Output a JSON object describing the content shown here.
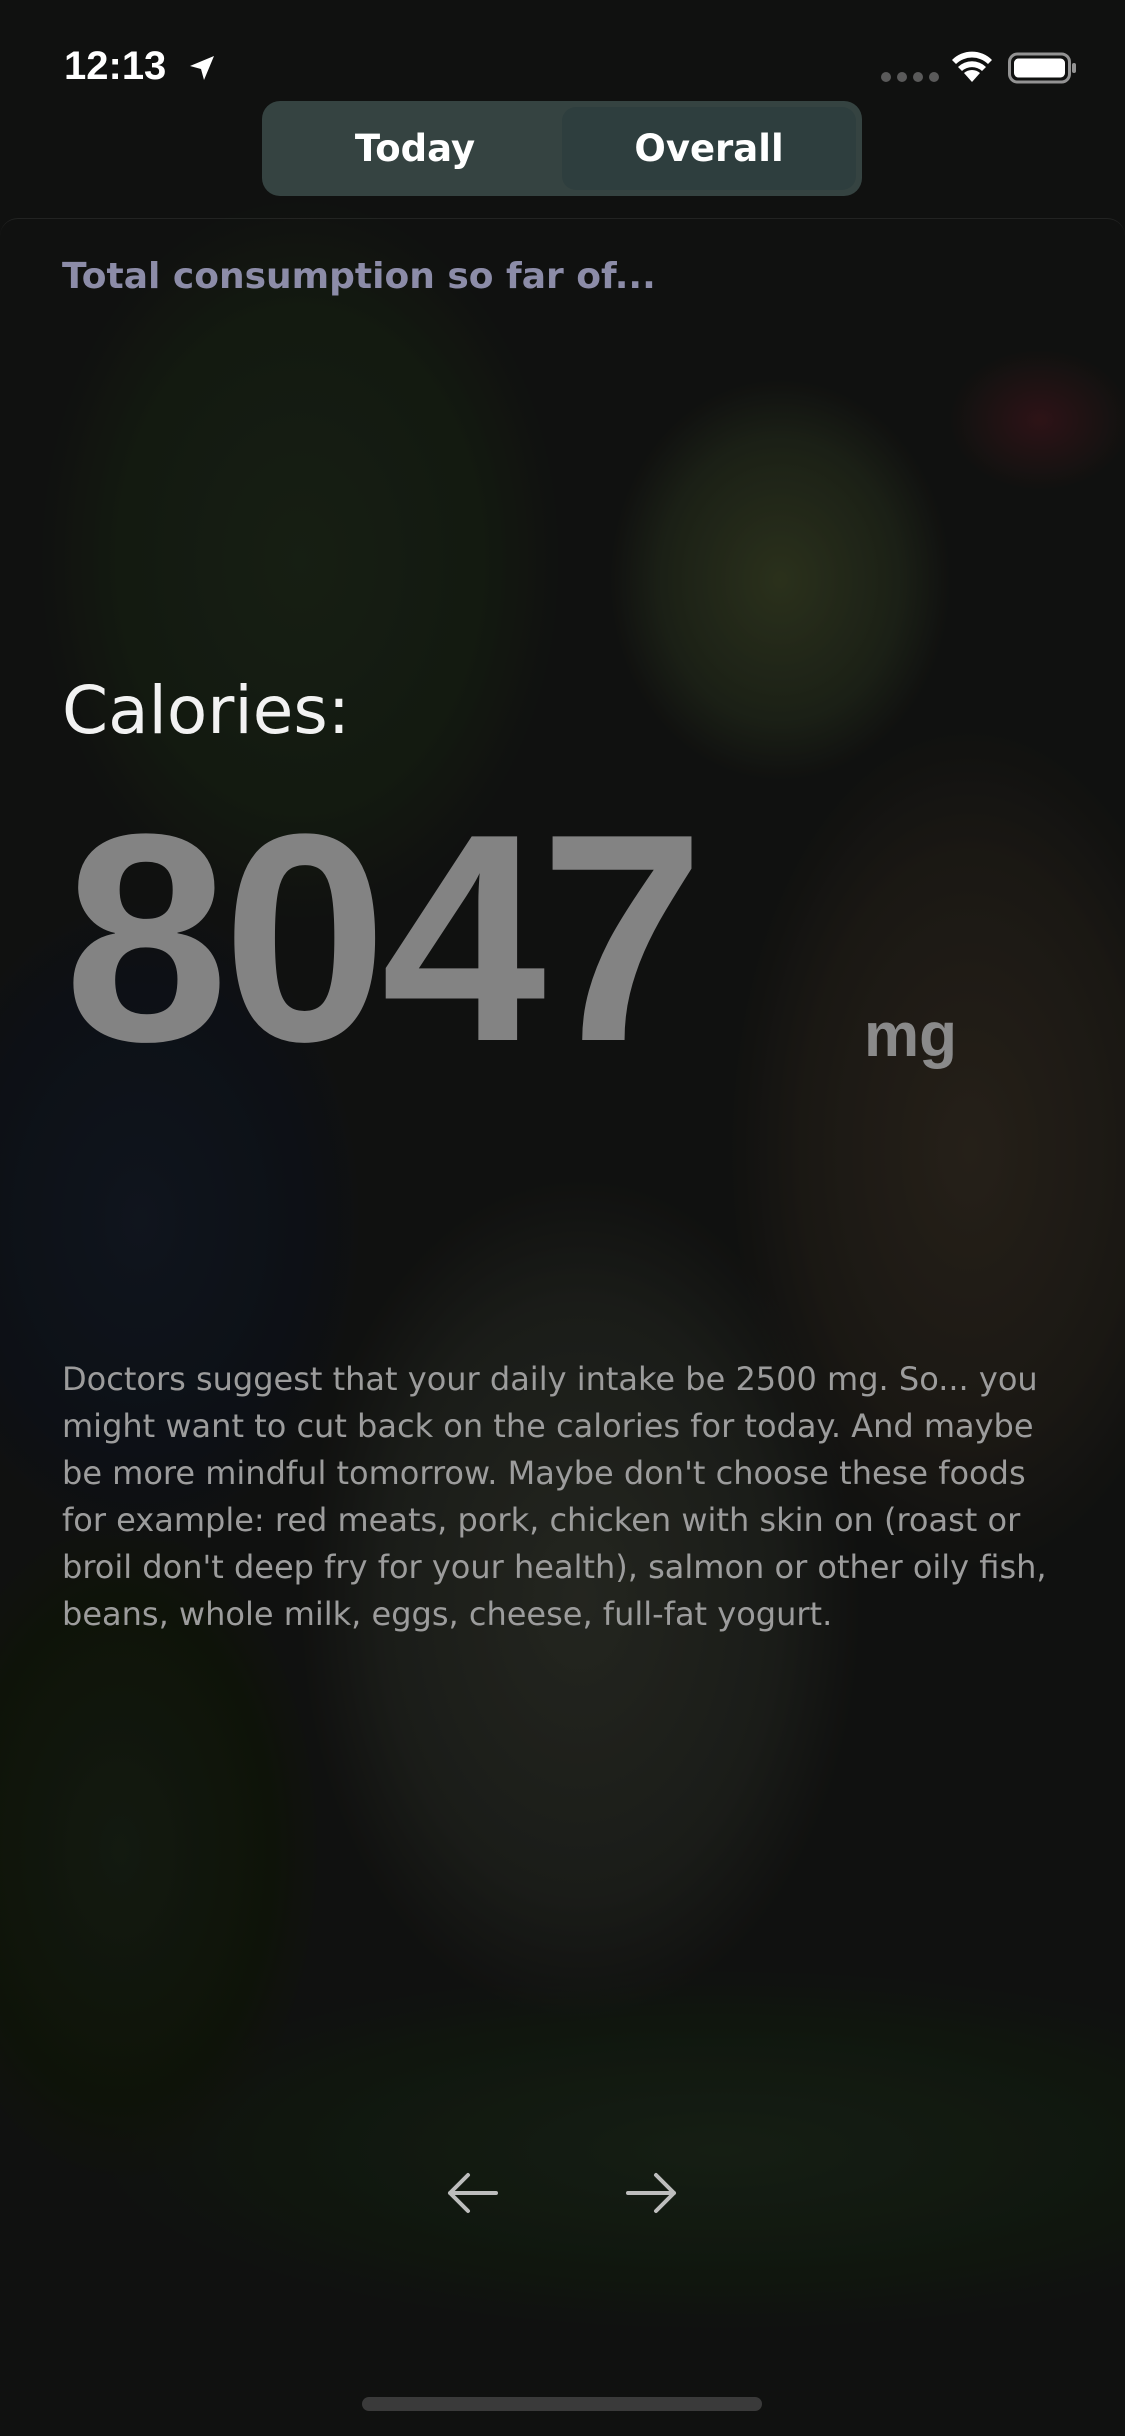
{
  "status_bar": {
    "time": "12:13",
    "location_icon": "location-arrow-icon",
    "signal_icon": "cellular-signal-icon",
    "wifi_icon": "wifi-icon",
    "battery_icon": "battery-icon"
  },
  "segmented_control": {
    "options": [
      "Today",
      "Overall"
    ],
    "selected": "Overall"
  },
  "content": {
    "subtitle": "Total consumption so far of...",
    "metric_label": "Calories:",
    "metric_value": "8047",
    "metric_unit": "mg",
    "advice": "Doctors suggest that your daily intake be 2500 mg. So... you might want to cut back on the calories for today. And maybe be more mindful tomorrow. Maybe don't choose these foods for example: red meats, pork, chicken with skin on (roast or broil don't deep fry for your health), salmon or other oily fish, beans, whole milk, eggs, cheese, full-fat yogurt."
  },
  "navigation": {
    "prev_icon": "arrow-left-icon",
    "next_icon": "arrow-right-icon"
  },
  "colors": {
    "subtitle": "#8c8ca8",
    "metric_value": "#838383",
    "segment_bg": "#3c4c4a"
  }
}
